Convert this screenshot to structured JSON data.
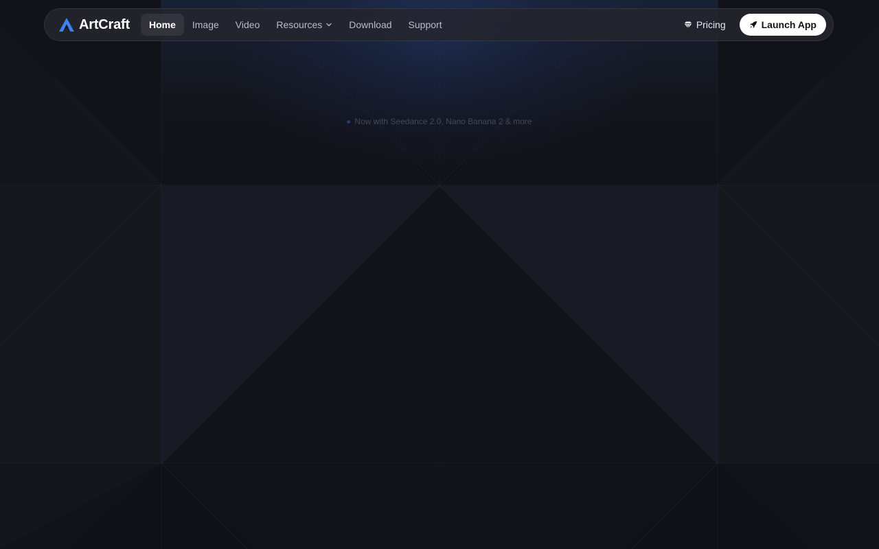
{
  "brand": {
    "name": "ArtCraft",
    "icon": "artcraft-logo-icon",
    "accent_color": "#3b82f6"
  },
  "nav": {
    "links": [
      {
        "label": "Home",
        "active": true
      },
      {
        "label": "Image",
        "active": false
      },
      {
        "label": "Video",
        "active": false
      },
      {
        "label": "Resources",
        "active": false,
        "has_dropdown": true,
        "icon": "chevron-down-icon"
      },
      {
        "label": "Download",
        "active": false
      },
      {
        "label": "Support",
        "active": false
      }
    ],
    "pricing": {
      "label": "Pricing",
      "icon": "gem-icon"
    },
    "launch": {
      "label": "Launch App",
      "icon": "rocket-icon"
    }
  },
  "hero": {
    "announcement": "Now with Seedance 2.0, Nano Banana 2 & more"
  },
  "colors": {
    "background": "#121318",
    "navbar": "#24262e",
    "launch_button": "#ffffff"
  }
}
